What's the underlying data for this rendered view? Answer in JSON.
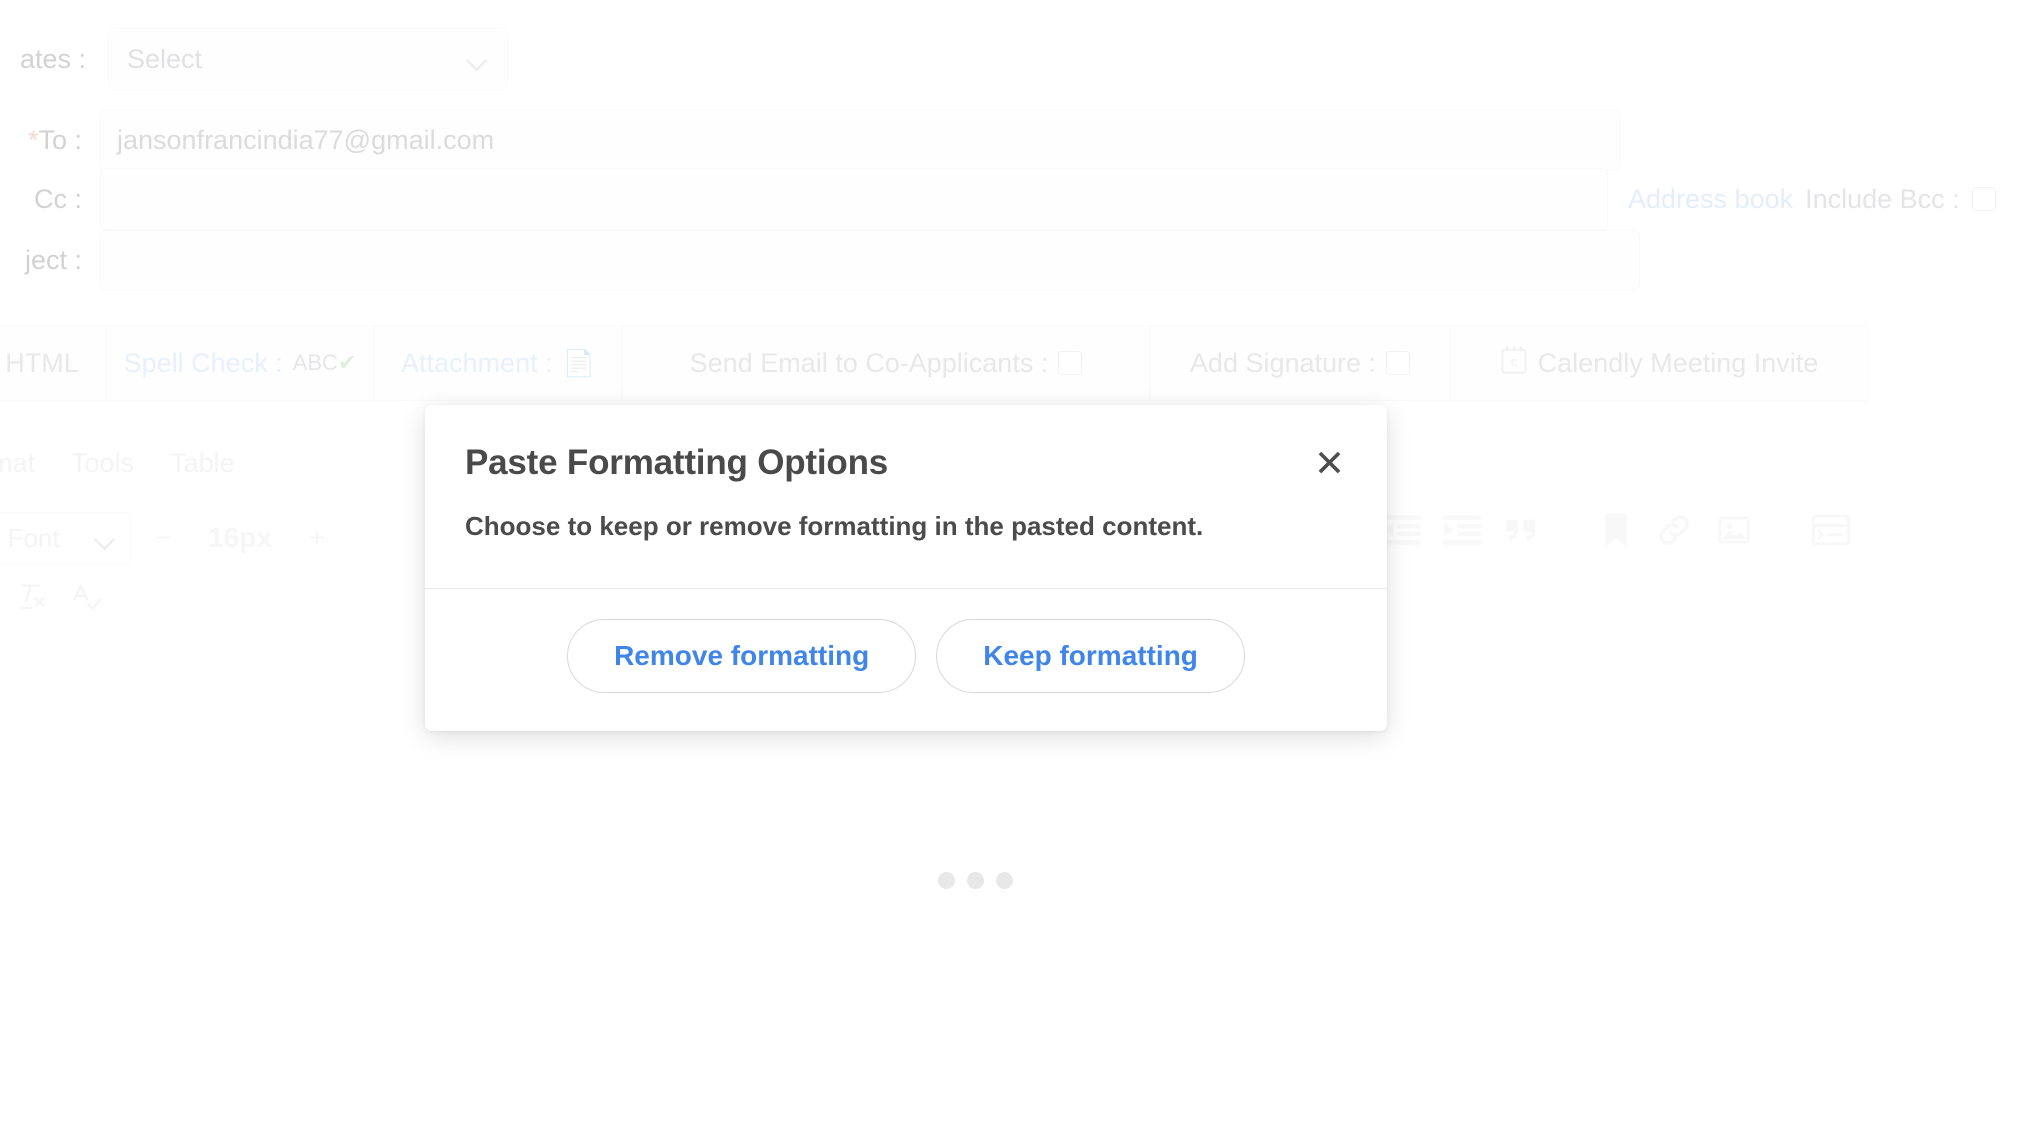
{
  "compose_form": {
    "templates": {
      "label": "ates :",
      "select_value": "Select",
      "chevron_icon": "chevron-down-icon"
    },
    "to": {
      "label_star": "*",
      "label": "To :",
      "value": "jansonfrancindia77@gmail.com"
    },
    "cc": {
      "label": "Cc :",
      "value": ""
    },
    "subject": {
      "label": "ject :",
      "value": ""
    },
    "address_book_link": "Address book",
    "include_bcc_label": "Include Bcc :",
    "options_bar": [
      {
        "label": "HTML",
        "icon": "",
        "style": "grey"
      },
      {
        "label": "Spell Check :",
        "icon": "ABC✔",
        "style": "blue"
      },
      {
        "label": "Attachment :",
        "icon": "📄",
        "style": "blue"
      },
      {
        "label": "Send Email to Co-Applicants :",
        "icon": "checkbox",
        "style": "grey"
      },
      {
        "label": "Add Signature :",
        "icon": "checkbox",
        "style": "grey"
      },
      {
        "label": "Calendly Meeting Invite",
        "icon": "calendar-icon",
        "style": "grey"
      }
    ],
    "editor": {
      "menus": [
        "ormat",
        "Tools",
        "Table"
      ],
      "font_family": "tem Font",
      "font_size": "16px",
      "decrease_label": "−",
      "increase_label": "+",
      "icons": [
        "clear-formatting-icon",
        "spellcheck-icon",
        "outdent-icon",
        "indent-icon",
        "blockquote-icon",
        "bookmark-icon",
        "link-icon",
        "image-icon",
        "template-icon"
      ]
    }
  },
  "loading_indicator": {
    "dots": 3
  },
  "modal": {
    "title": "Paste Formatting Options",
    "close_label": "✕",
    "message": "Choose to keep or remove formatting in the pasted content.",
    "buttons": {
      "remove": "Remove formatting",
      "keep": "Keep formatting"
    },
    "accent_color": "#4085e8"
  }
}
